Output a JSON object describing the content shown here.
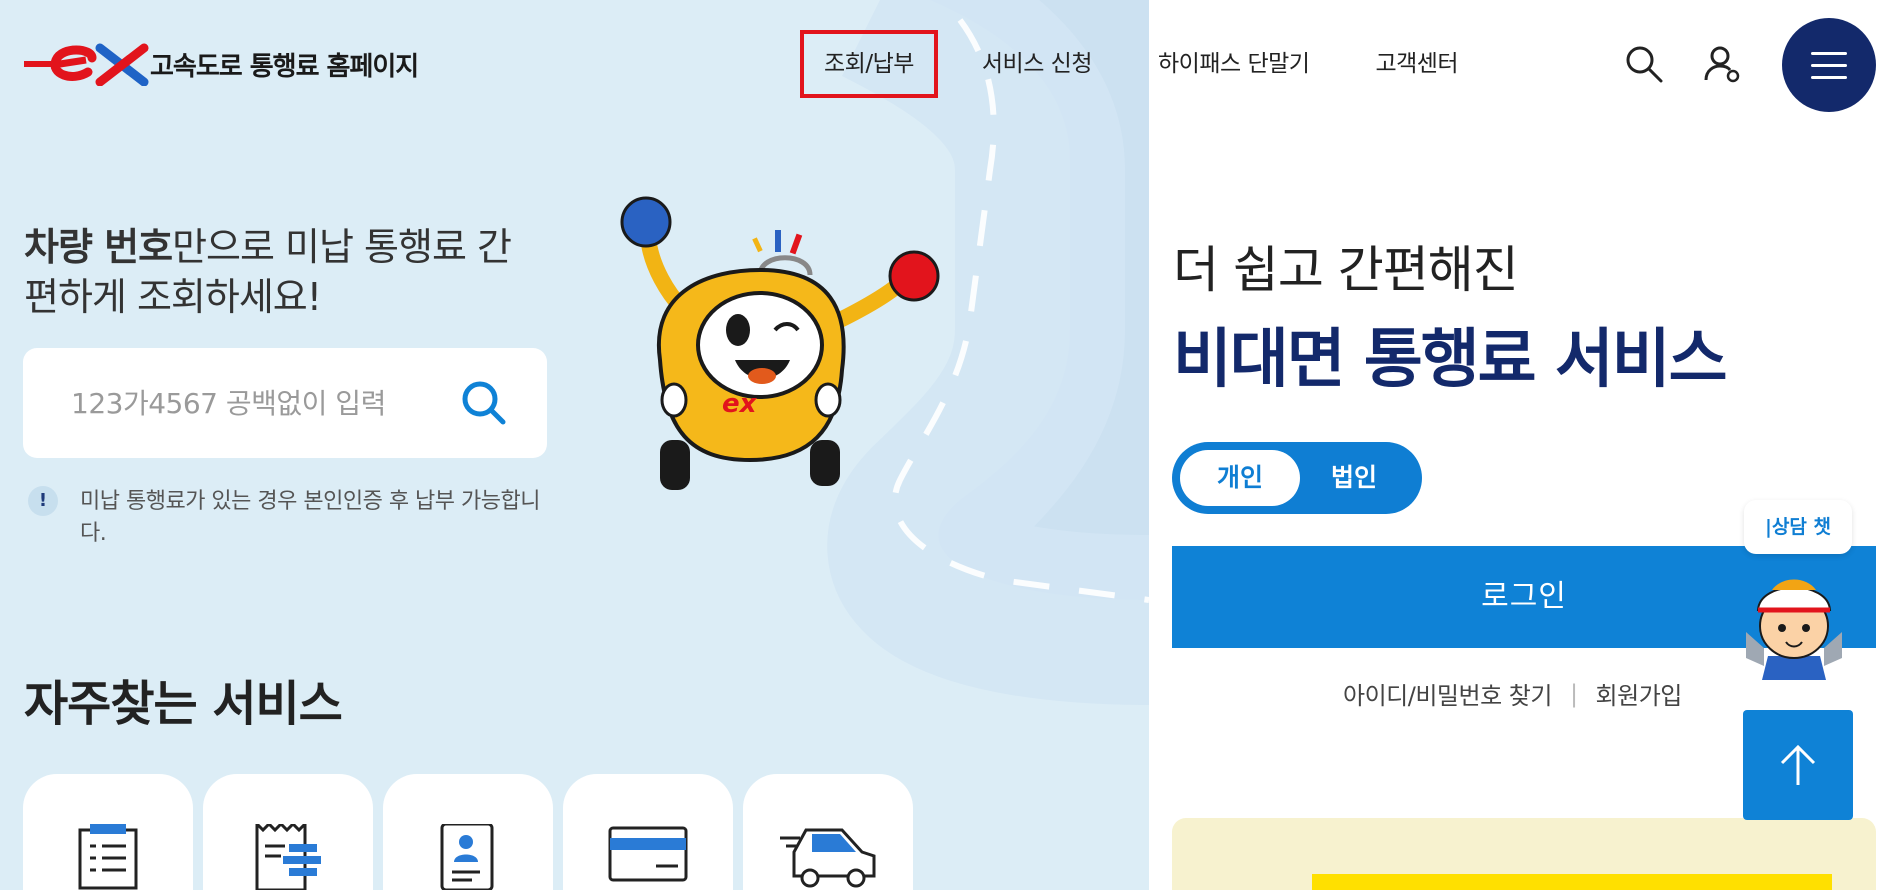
{
  "header": {
    "logo_text": "고속도로 통행료 홈페이지",
    "nav": [
      {
        "label": "조회/납부",
        "active": true
      },
      {
        "label": "서비스 신청",
        "active": false
      },
      {
        "label": "하이패스 단말기",
        "active": false
      },
      {
        "label": "고객센터",
        "active": false
      }
    ],
    "icons": [
      "search-icon",
      "user-icon",
      "menu-icon"
    ]
  },
  "hero": {
    "headline_bold": "차량 번호",
    "headline_rest": "만으로 미납 통행료 간편하게 조회하세요!",
    "search": {
      "placeholder": "123가4567 공백없이 입력",
      "value": ""
    },
    "notice": "미납 통행료가 있는 경우 본인인증 후 납부 가능합니다."
  },
  "services": {
    "title": "자주찾는 서비스",
    "icons": [
      "clipboard-list-icon",
      "receipt-icon",
      "id-card-icon",
      "credit-card-icon",
      "vehicle-icon"
    ]
  },
  "login_panel": {
    "subtitle": "더 쉽고 간편해진",
    "title": "비대면 통행료 서비스",
    "toggle": [
      "개인",
      "법인"
    ],
    "selected_toggle": "개인",
    "login_button": "로그인",
    "find_account": "아이디/비밀번호 찾기",
    "separator": "|",
    "signup": "회원가입"
  },
  "floating": {
    "chat_label": "|상담 챗",
    "top_button": "up-arrow-icon"
  },
  "colors": {
    "left_bg": "#dcedf6",
    "navy": "#13296b",
    "blue": "#0f82d6",
    "active_border": "#e2141c",
    "promo_bg": "#f7f2cf"
  }
}
